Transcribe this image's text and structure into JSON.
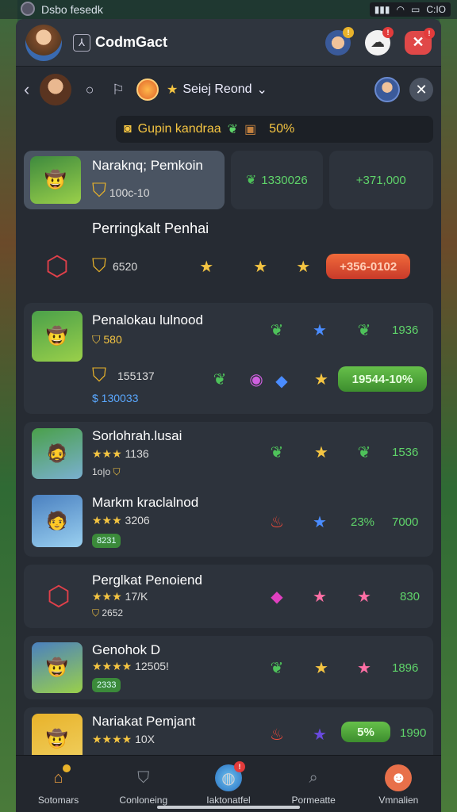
{
  "status": {
    "title": "Dsbo fesedk",
    "time": "C:IO"
  },
  "header": {
    "app_title": "CodmGact"
  },
  "subbar": {
    "season": "Seiej Reond"
  },
  "promo": {
    "label": "Gupin kandraa",
    "percent": "50%"
  },
  "top_card": {
    "name": "Naraknq; Pemkoin",
    "score": "100c-10",
    "stat1": "1330026",
    "stat2": "+371,000"
  },
  "rank_card": {
    "title": "Perringkalt Penhai",
    "score": "6520",
    "pill": "+356-0102"
  },
  "cards": [
    {
      "name": "Penalokau lulnood",
      "sub": "580",
      "score": "155137",
      "sub2": "$ 130033",
      "val": "1936",
      "pill": "19544-10%"
    },
    {
      "name": "Sorlohrah.lusai",
      "sub": "1136",
      "sub2": "1o|o",
      "val": "1536"
    },
    {
      "name": "Markm kraclalnod",
      "sub": "3206",
      "badge": "8231",
      "pct": "23%",
      "val": "7000"
    },
    {
      "name": "Perglkat Penoiend",
      "sub": "17/K",
      "sub2": "2652",
      "val": "830"
    },
    {
      "name": "Genohok D",
      "sub": "12505!",
      "badge": "2333",
      "val": "1896"
    },
    {
      "name": "Nariakat Pemjant",
      "sub": "10X",
      "pct": "5%",
      "val": "1990"
    }
  ],
  "nav": [
    {
      "label": "Sotomars",
      "icon": "home-icon"
    },
    {
      "label": "Conloneing",
      "icon": "shield-icon"
    },
    {
      "label": "Iaktonatfel",
      "icon": "globe-icon"
    },
    {
      "label": "Pormeatte",
      "icon": "search-icon"
    },
    {
      "label": "Vmnalien",
      "icon": "profile-icon"
    }
  ]
}
